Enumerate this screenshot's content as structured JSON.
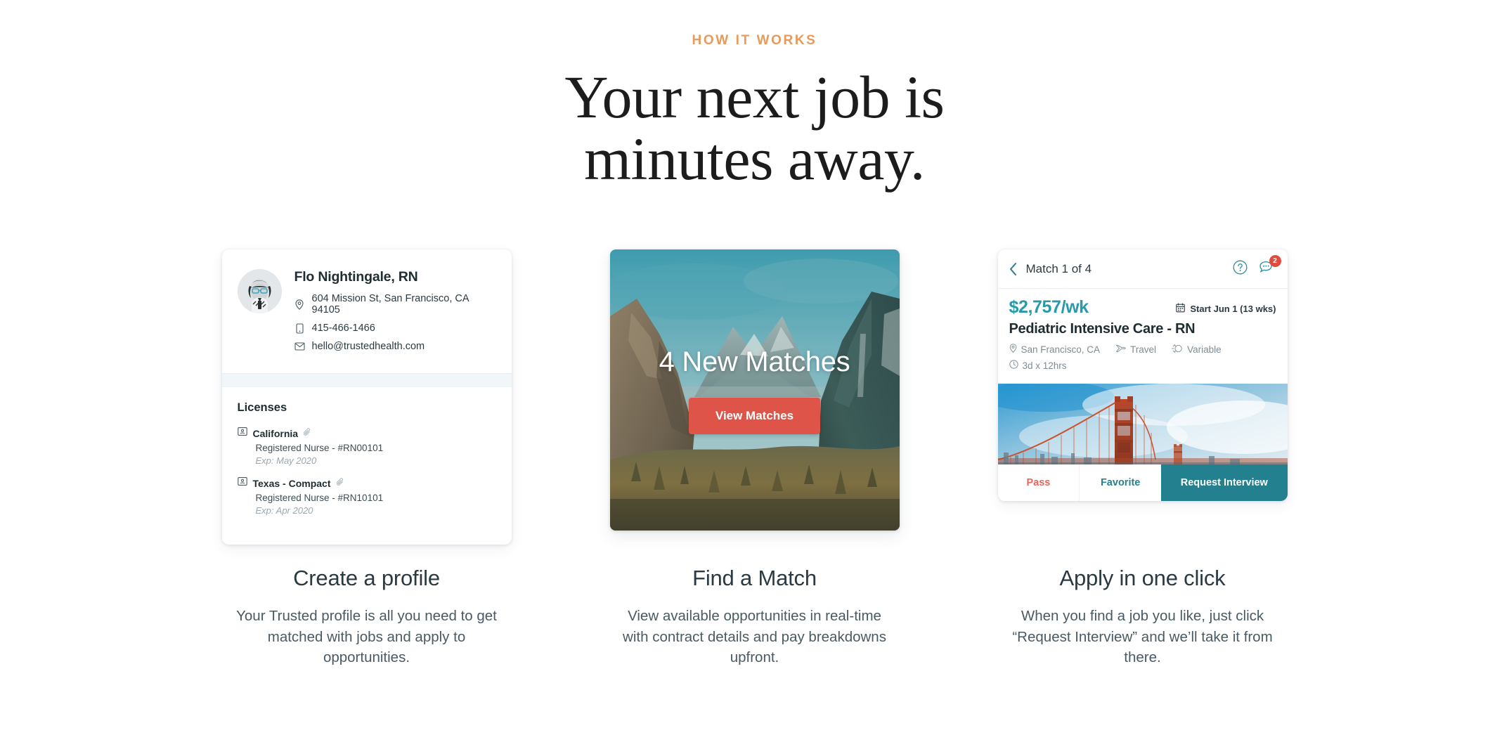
{
  "header": {
    "eyebrow": "HOW IT WORKS",
    "headline_line1": "Your next job is",
    "headline_line2": "minutes away.",
    "accent_color": "#E89A5C"
  },
  "columns": [
    {
      "caption_title": "Create a profile",
      "caption_body": "Your Trusted profile is all you need to get matched with jobs and apply to opportunities.",
      "card": {
        "type": "profile",
        "name": "Flo Nightingale, RN",
        "address": "604 Mission St, San Francisco, CA 94105",
        "phone": "415-466-1466",
        "email": "hello@trustedhealth.com",
        "licenses_heading": "Licenses",
        "licenses": [
          {
            "state": "California",
            "detail": "Registered Nurse - #RN00101",
            "expiry": "Exp: May 2020"
          },
          {
            "state": "Texas - Compact",
            "detail": "Registered Nurse - #RN10101",
            "expiry": "Exp: Apr 2020"
          }
        ]
      }
    },
    {
      "caption_title": "Find a Match",
      "caption_body": "View available opportunities in real-time with contract details and pay breakdowns upfront.",
      "card": {
        "type": "matches",
        "title": "4 New Matches",
        "button_label": "View Matches",
        "button_color": "#DF5448",
        "photo_description": "yosemite-valley-photo"
      }
    },
    {
      "caption_title": "Apply in one click",
      "caption_body": "When you find a job you like, just click “Request Interview” and we’ll take it from there.",
      "card": {
        "type": "job-match",
        "header_title": "Match 1 of 4",
        "message_badge_count": "2",
        "pay": "$2,757/wk",
        "pay_color": "#2A9AA8",
        "start": "Start Jun 1 (13 wks)",
        "job_title": "Pediatric Intensive Care - RN",
        "meta": [
          {
            "icon": "location-pin-icon",
            "label": "San Francisco, CA"
          },
          {
            "icon": "airplane-icon",
            "label": "Travel"
          },
          {
            "icon": "shift-icon",
            "label": "Variable"
          }
        ],
        "schedule": "3d x 12hrs",
        "photo_description": "golden-gate-bridge-photo",
        "actions": [
          {
            "label": "Pass",
            "color": "#E4695C"
          },
          {
            "label": "Favorite",
            "color": "#2A7F8E"
          },
          {
            "label": "Request Interview",
            "color": "#FFFFFF",
            "background": "#22808F"
          }
        ]
      }
    }
  ]
}
